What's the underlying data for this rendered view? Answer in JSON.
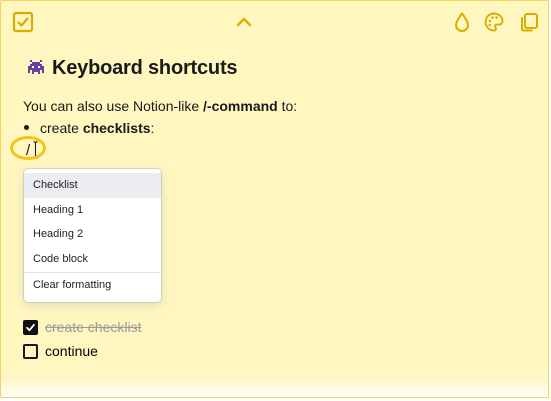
{
  "toolbar": {
    "left_icon": "checkbox-note-icon",
    "center_icon": "chevron-up-icon",
    "right_icons": [
      "drop-icon",
      "palette-icon",
      "copy-icon"
    ],
    "accent_color": "#d9ad00",
    "note_color": "#fff6c0"
  },
  "note": {
    "title": "Keyboard shortcuts",
    "title_icon": "space-invader-icon",
    "intro_prefix": "You can also use Notion-like ",
    "intro_command": "/-command",
    "intro_suffix": " to:",
    "bullet_prefix": "create ",
    "bullet_bold": "checklists",
    "bullet_suffix": ":",
    "slash_text": "/"
  },
  "slash_menu": {
    "items": [
      "Checklist",
      "Heading 1",
      "Heading 2",
      "Code block"
    ],
    "footer_item": "Clear formatting",
    "selected_item": "Checklist"
  },
  "tasks": [
    {
      "label": "create checklist",
      "checked": true
    },
    {
      "label": "continue",
      "checked": false
    }
  ]
}
